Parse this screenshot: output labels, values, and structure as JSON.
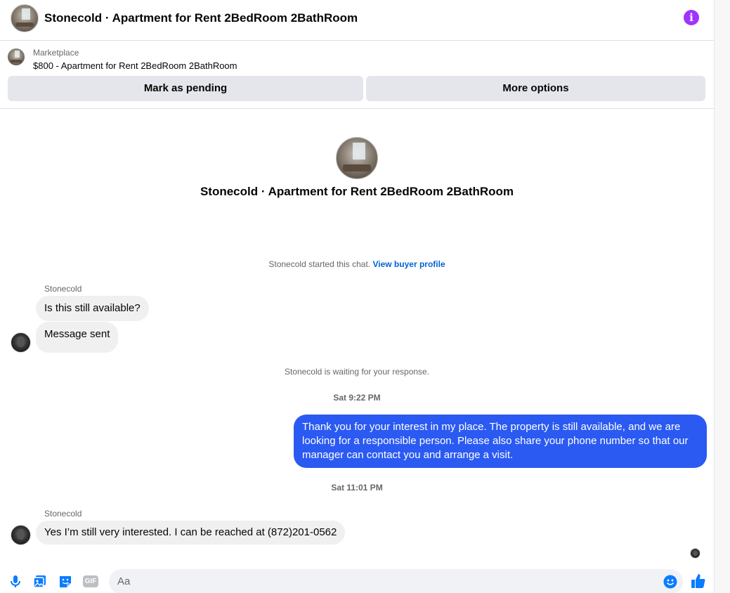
{
  "header": {
    "title": "Stonecold · Apartment for Rent 2BedRoom 2BathRoom",
    "info_glyph": "i",
    "accent_color": "#a033ff"
  },
  "marketplace": {
    "label": "Marketplace",
    "listing": "$800 - Apartment for Rent 2BedRoom 2BathRoom",
    "pending_label": "Mark as pending",
    "more_label": "More options"
  },
  "intro": {
    "title": "Stonecold · Apartment for Rent 2BedRoom 2BathRoom",
    "started_text": "Stonecold started this chat.",
    "profile_link": "View buyer profile"
  },
  "messages": {
    "group1": {
      "sender": "Stonecold",
      "msg1": "Is this still available?",
      "msg2": "Message sent"
    },
    "waiting": "Stonecold is waiting for your response.",
    "time1": "Sat 9:22 PM",
    "outgoing": "Thank you for your interest in my place. The property is still available, and we are looking for a responsible person. Please also share your phone number so that our manager can contact you and arrange a visit.",
    "time2": "Sat 11:01 PM",
    "group2": {
      "sender": "Stonecold",
      "msg1": "Yes I’m still very interested. I can be reached at (872)201-0562"
    }
  },
  "composer": {
    "placeholder": "Aa",
    "icon_color": "#0a7cff",
    "gif_label": "GIF"
  }
}
